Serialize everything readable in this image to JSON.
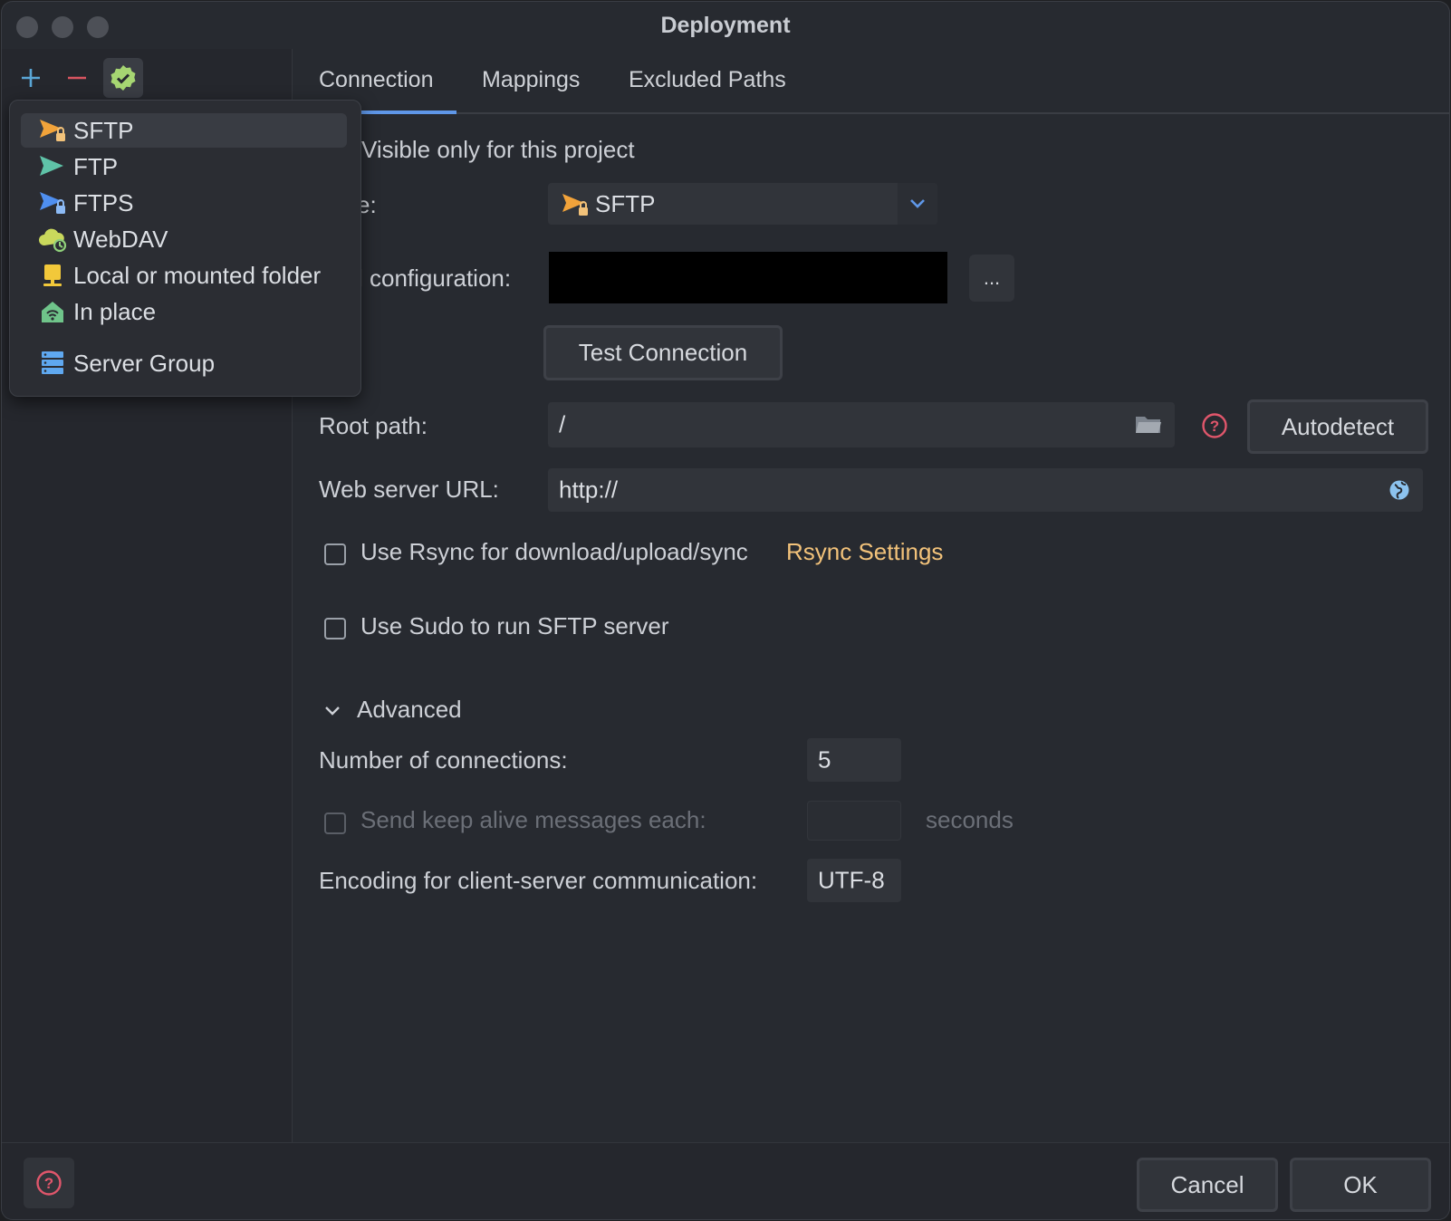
{
  "window": {
    "title": "Deployment"
  },
  "sidebar": {
    "toolbar": {
      "add_icon": "plus-icon",
      "remove_icon": "minus-icon",
      "default_icon": "check-badge-icon"
    }
  },
  "popup": {
    "items": [
      {
        "label": "SFTP",
        "icon": "sftp-icon"
      },
      {
        "label": "FTP",
        "icon": "ftp-icon"
      },
      {
        "label": "FTPS",
        "icon": "ftps-icon"
      },
      {
        "label": "WebDAV",
        "icon": "webdav-icon"
      },
      {
        "label": "Local or mounted folder",
        "icon": "local-folder-icon"
      },
      {
        "label": "In place",
        "icon": "in-place-icon"
      },
      {
        "label": "Server Group",
        "icon": "server-group-icon"
      }
    ]
  },
  "tabs": [
    {
      "label": "Connection"
    },
    {
      "label": "Mappings"
    },
    {
      "label": "Excluded Paths"
    }
  ],
  "connection": {
    "visible_only_label": "Visible only for this project",
    "type_label": "e:",
    "type_value": "SFTP",
    "ssh_config_label": "l configuration:",
    "browse_label": "...",
    "test_connection": "Test Connection",
    "root_path_label": "Root path:",
    "root_path_value": "/",
    "autodetect": "Autodetect",
    "web_url_label": "Web server URL:",
    "web_url_value": "http://",
    "rsync_label": "Use Rsync for download/upload/sync",
    "rsync_link": "Rsync Settings",
    "sudo_label": "Use Sudo to run SFTP server",
    "advanced_label": "Advanced",
    "num_conn_label": "Number of connections:",
    "num_conn_value": "5",
    "keepalive_label": "Send keep alive messages each:",
    "keepalive_unit": "seconds",
    "encoding_label": "Encoding for client-server communication:",
    "encoding_value": "UTF-8"
  },
  "footer": {
    "cancel": "Cancel",
    "ok": "OK"
  },
  "colors": {
    "accent": "#5f97e8",
    "link": "#f2c27a",
    "help": "#e0566b"
  }
}
